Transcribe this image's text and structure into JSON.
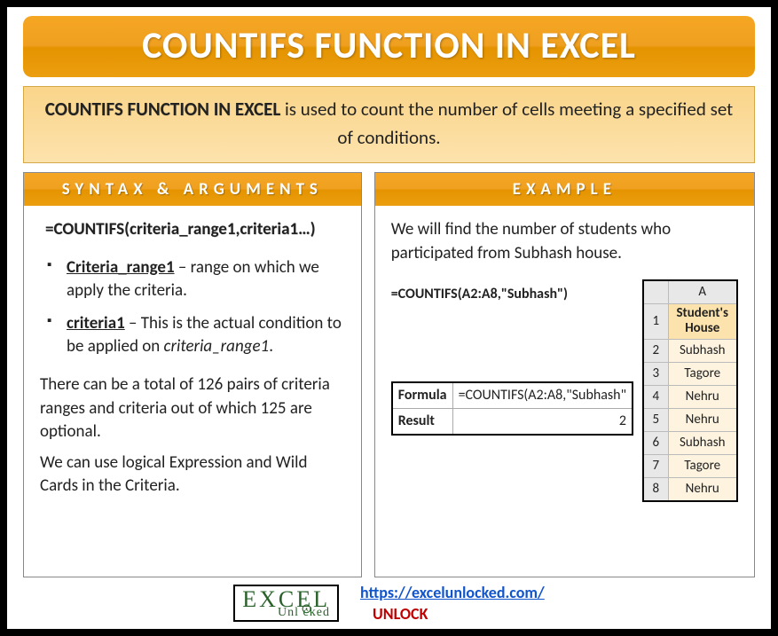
{
  "title": "COUNTIFS FUNCTION IN EXCEL",
  "description": {
    "lead": "COUNTIFS FUNCTION IN EXCEL",
    "rest": " is used to count the number of cells meeting a specified set of conditions."
  },
  "syntax": {
    "header": "SYNTAX & ARGUMENTS",
    "formula": "=COUNTIFS(criteria_range1,criteria1…)",
    "args": [
      {
        "name": "Criteria_range1",
        "desc": " – range on which we apply the criteria."
      },
      {
        "name": "criteria1",
        "desc_pre": " – This is the actual condition to be applied on ",
        "desc_italic": "criteria_range1",
        "desc_post": "."
      }
    ],
    "note1": "There can be a total of 126 pairs of criteria ranges and criteria out of which 125 are optional.",
    "note2": "We can use logical Expression and Wild Cards in the Criteria."
  },
  "example": {
    "header": "EXAMPLE",
    "intro": "We will find the number of students who participated from Subhash house.",
    "formula": "=COUNTIFS(A2:A8,\"Subhash\")",
    "result_table": {
      "formula_label": "Formula",
      "formula_value": "=COUNTIFS(A2:A8,\"Subhash\"",
      "result_label": "Result",
      "result_value": "2"
    },
    "sheet": {
      "col": "A",
      "header": "Student's House",
      "rows": [
        "Subhash",
        "Tagore",
        "Nehru",
        "Nehru",
        "Subhash",
        "Tagore",
        "Nehru"
      ]
    }
  },
  "footer": {
    "logo_top": "EXCEL",
    "logo_bottom": "Unl  cked",
    "url": "https://excelunlocked.com/",
    "unlock": "UNLOCK"
  }
}
